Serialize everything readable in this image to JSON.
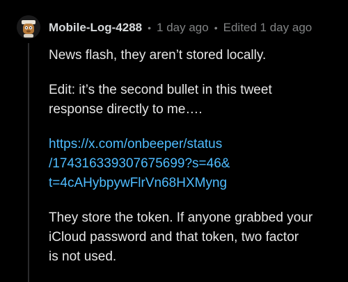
{
  "comment": {
    "author": "Mobile-Log-4288",
    "separator": "•",
    "time_ago": "1 day ago",
    "edited": "Edited 1 day ago",
    "paragraphs": {
      "p1": "News flash, they aren’t stored locally.",
      "p2_line1": "Edit: it’s the second bullet in this tweet",
      "p2_line2": "response directly to me….",
      "link_line1": "https://x.com/onbeeper/status",
      "link_line2": "/1743163393076756​99?s=46&",
      "link_line3": "t=4cAHybpywFlrVn68HXMyng",
      "p4_line1": "They store the token. If anyone grabbed your",
      "p4_line2": "iCloud password and that token, two factor",
      "p4_line3": "is not used."
    }
  },
  "colors": {
    "background": "#000000",
    "text": "#e6e6e6",
    "meta": "#818384",
    "link": "#4fbcff"
  },
  "icons": {
    "avatar": "avatar-icon"
  }
}
